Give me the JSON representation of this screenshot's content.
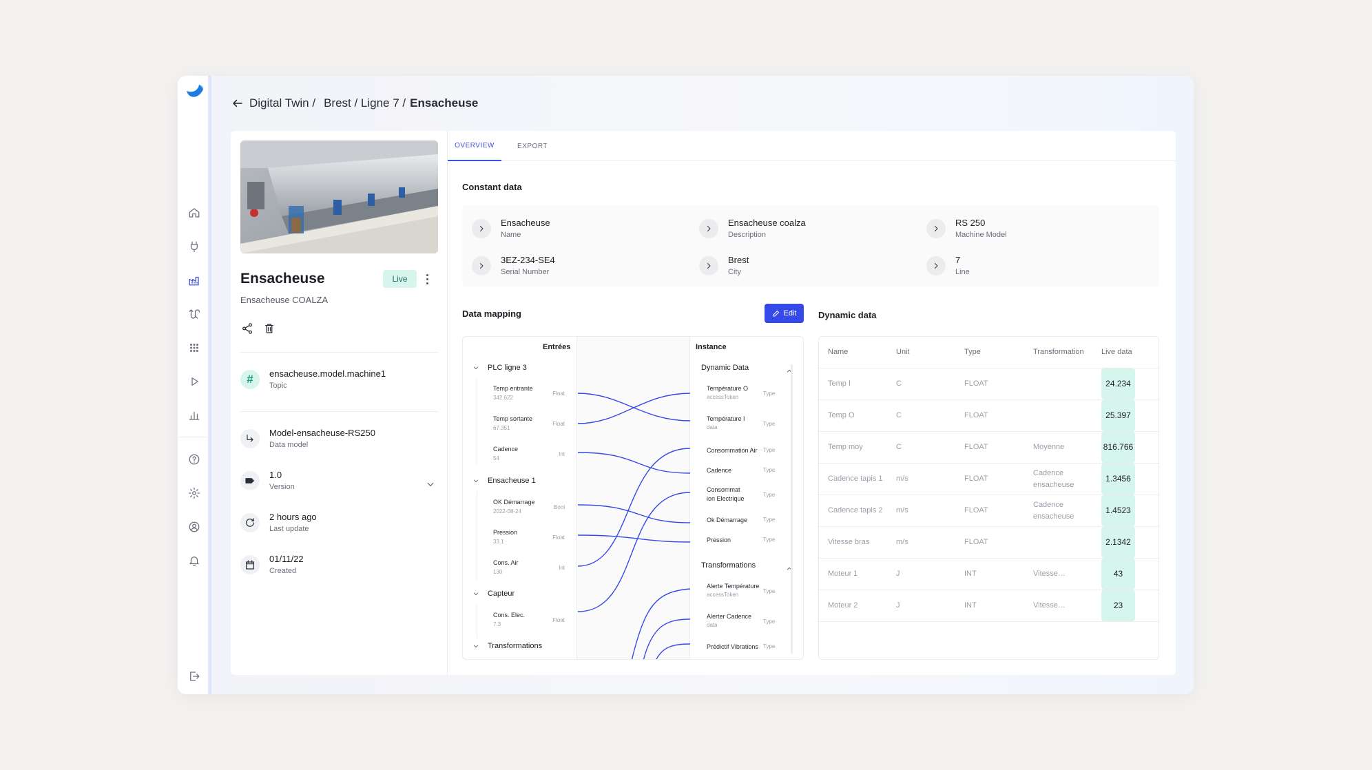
{
  "breadcrumb": {
    "root": "Digital Twin /",
    "path": "Brest / Ligne 7 /",
    "current": "Ensacheuse"
  },
  "machine": {
    "name": "Ensacheuse",
    "subtitle": "Ensacheuse COALZA",
    "status": "Live"
  },
  "meta": [
    {
      "value": "ensacheuse.model.machine1",
      "label": "Topic",
      "icon": "hash-icon"
    },
    {
      "value": "Model-ensacheuse-RS250",
      "label": "Data model",
      "icon": "subdirectory-arrow-icon"
    },
    {
      "value": "1.0",
      "label": "Version",
      "icon": "tag-icon"
    },
    {
      "value": "2 hours ago",
      "label": "Last update",
      "icon": "refresh-icon"
    },
    {
      "value": "01/11/22",
      "label": "Created",
      "icon": "calendar-icon"
    }
  ],
  "tabs": [
    "OVERVIEW",
    "EXPORT"
  ],
  "constant": {
    "title": "Constant data",
    "items": [
      {
        "value": "Ensacheuse",
        "label": "Name"
      },
      {
        "value": "Ensacheuse coalza",
        "label": "Description"
      },
      {
        "value": "RS 250",
        "label": "Machine Model"
      },
      {
        "value": "3EZ-234-SE4",
        "label": "Serial Number"
      },
      {
        "value": "Brest",
        "label": "City"
      },
      {
        "value": "7",
        "label": "Line"
      }
    ]
  },
  "mapping": {
    "title": "Data mapping",
    "edit_label": "Edit",
    "inputs_header": "Entrées",
    "instance_header": "Instance",
    "groups": [
      "PLC ligne 3",
      "Ensacheuse 1",
      "Capteur",
      "Transformations"
    ],
    "inputs": [
      {
        "name": "Temp entrante",
        "sample": "342.622",
        "type": "Float"
      },
      {
        "name": "Temp sortante",
        "sample": "67.351",
        "type": "Float"
      },
      {
        "name": "Cadence",
        "sample": "54",
        "type": "Int"
      },
      {
        "name": "OK Démarrage",
        "sample": "2022-08-24",
        "type": "Bool"
      },
      {
        "name": "Pression",
        "sample": "33.1",
        "type": "Float"
      },
      {
        "name": "Cons. Air",
        "sample": "130",
        "type": "Int"
      },
      {
        "name": "Cons. Elec.",
        "sample": "7.3",
        "type": "Float"
      }
    ],
    "instance_groups": [
      "Dynamic Data",
      "Transformations"
    ],
    "instance": [
      {
        "name": "Température O",
        "sample": "accessToken",
        "type": "Type"
      },
      {
        "name": "Température I",
        "sample": "data",
        "type": "Type"
      },
      {
        "name": "Consommation Air",
        "sample": "",
        "type": "Type"
      },
      {
        "name": "Cadence",
        "sample": "",
        "type": "Type"
      },
      {
        "name": "Consommat",
        "sample": "ion Electrique",
        "type": "Type"
      },
      {
        "name": "Ok Démarrage",
        "sample": "",
        "type": "Type"
      },
      {
        "name": "Pression",
        "sample": "",
        "type": "Type"
      },
      {
        "name": "Alerte Température",
        "sample": "accessToken",
        "type": "Type"
      },
      {
        "name": "Alerter Cadence",
        "sample": "data",
        "type": "Type"
      },
      {
        "name": "Prédictif Vibrations",
        "sample": "",
        "type": "Type"
      }
    ]
  },
  "dynamic": {
    "title": "Dynamic data",
    "headers": [
      "Name",
      "Unit",
      "Type",
      "Transformation",
      "Live data"
    ],
    "rows": [
      [
        "Temp I",
        "C",
        "FLOAT",
        "",
        "24.234"
      ],
      [
        "Temp O",
        "C",
        "FLOAT",
        "",
        "25.397"
      ],
      [
        "Temp moy",
        "C",
        "FLOAT",
        "Moyenne",
        "816.766"
      ],
      [
        "Cadence tapis 1",
        "m/s",
        "FLOAT",
        "Cadence ensacheuse",
        "1.3456"
      ],
      [
        "Cadence tapis 2",
        "m/s",
        "FLOAT",
        "Cadence ensacheuse",
        "1.4523"
      ],
      [
        "Vitesse bras",
        "m/s",
        "FLOAT",
        "",
        "2.1342"
      ],
      [
        "Moteur 1",
        "J",
        "INT",
        "Vitesse…",
        "43"
      ],
      [
        "Moteur 2",
        "J",
        "INT",
        "Vitesse…",
        "23"
      ]
    ]
  },
  "colors": {
    "accent": "#3b4fe0",
    "live_bg": "#d6f5ec",
    "line": "#3548e8"
  }
}
